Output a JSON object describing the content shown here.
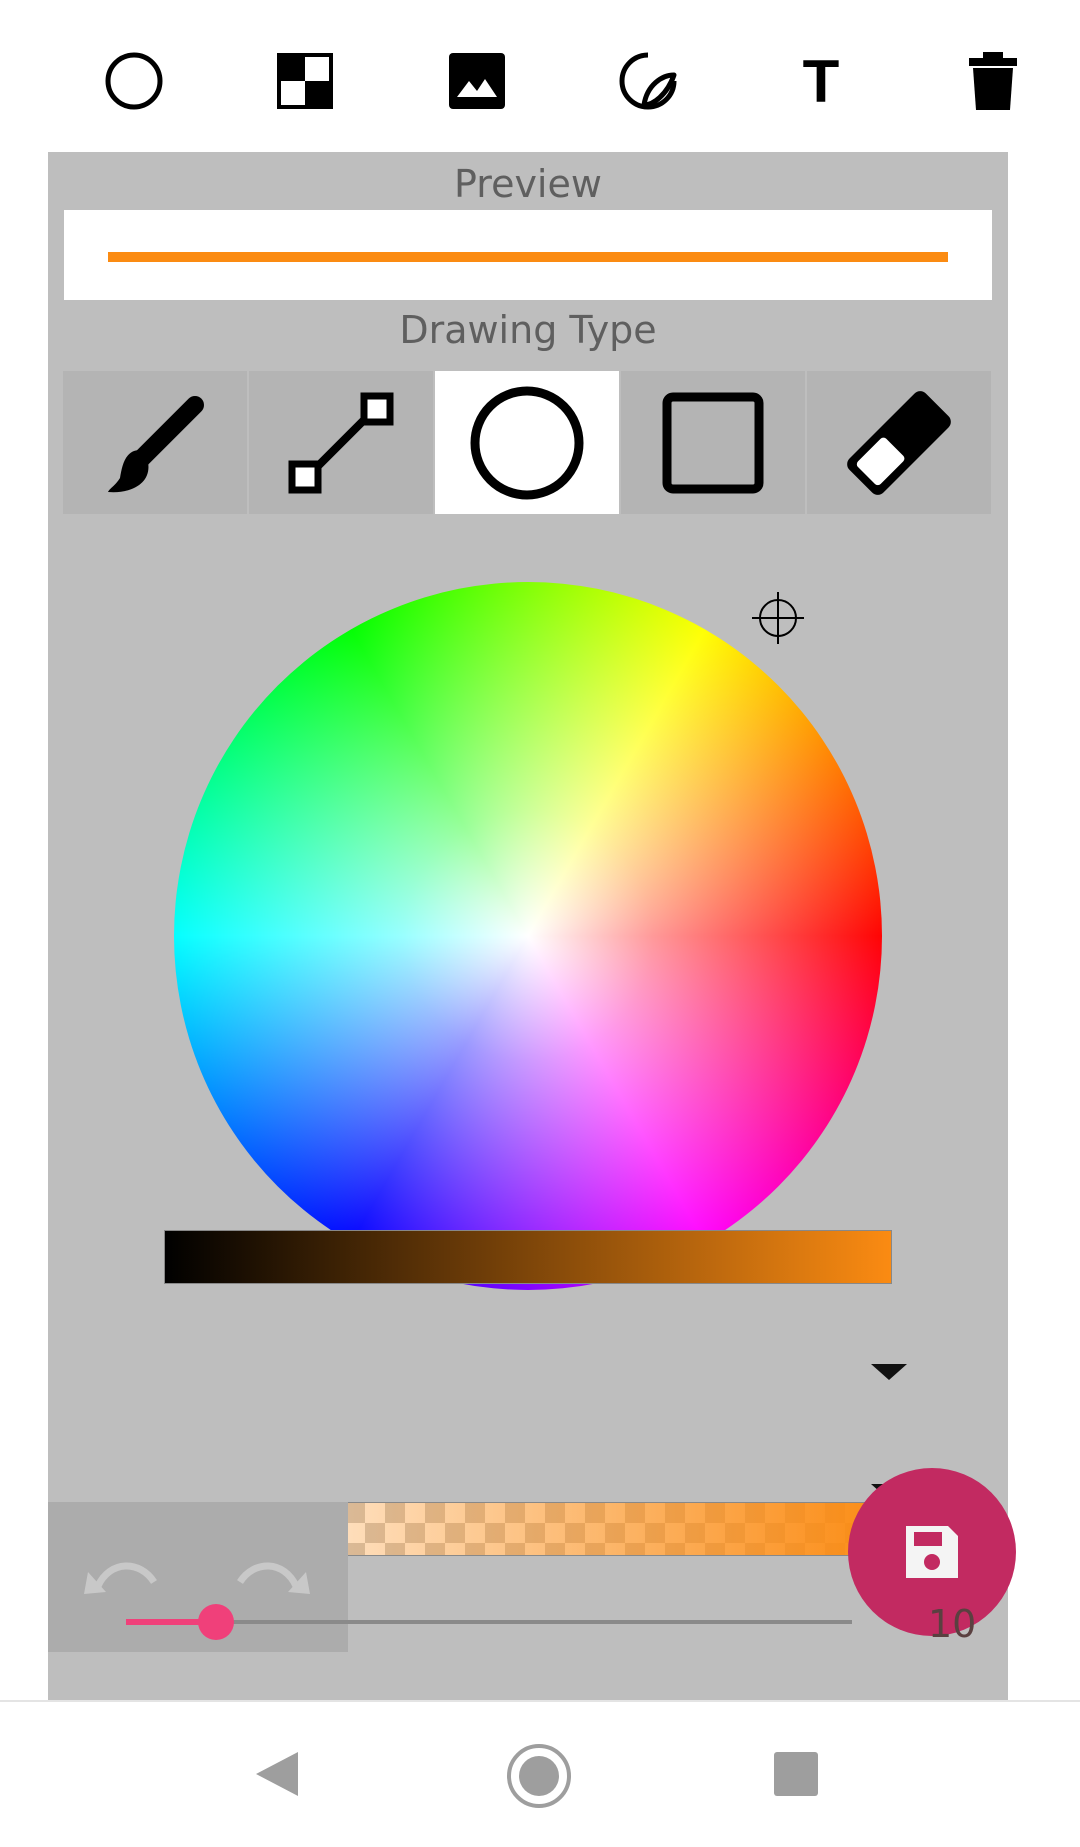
{
  "toolbar": {
    "items": [
      {
        "name": "circle-icon"
      },
      {
        "name": "checkerboard-icon"
      },
      {
        "name": "image-icon"
      },
      {
        "name": "sticker-icon"
      },
      {
        "name": "text-icon",
        "glyph": "T"
      },
      {
        "name": "trash-icon"
      }
    ]
  },
  "panel": {
    "preview_label": "Preview",
    "drawing_type_label": "Drawing Type",
    "drawing_types": [
      {
        "name": "brush",
        "selected": false
      },
      {
        "name": "line",
        "selected": false
      },
      {
        "name": "circle",
        "selected": true
      },
      {
        "name": "rectangle",
        "selected": false
      },
      {
        "name": "eraser",
        "selected": false
      }
    ],
    "current_color": "#fb8b12",
    "brightness": 1.0,
    "opacity": 1.0
  },
  "controls": {
    "size_value": "10",
    "slider_value": 0.1,
    "accent_color": "#f0407a",
    "save_color": "#c22a61"
  },
  "navbar": {
    "items": [
      {
        "name": "back"
      },
      {
        "name": "home"
      },
      {
        "name": "recents"
      }
    ]
  }
}
